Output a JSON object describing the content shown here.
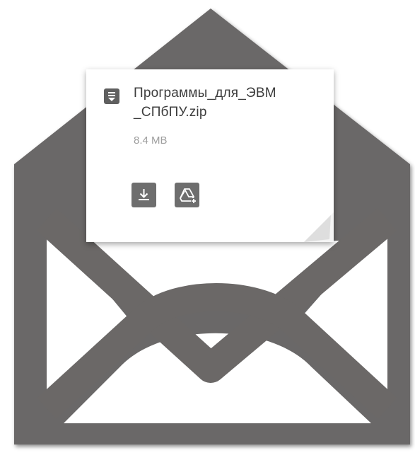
{
  "attachment": {
    "file_name_line1": "Программы_для_ЭВМ",
    "file_name_line2": "_СПбПУ.zip",
    "file_size": "8.4 MB",
    "file_icon": "archive-file-icon",
    "actions": [
      {
        "icon": "download-icon"
      },
      {
        "icon": "save-to-drive-icon"
      }
    ]
  },
  "colors": {
    "envelope": "#6b6867",
    "card_background": "#ffffff",
    "button_background": "#6e6e6e",
    "file_name_text": "#3d3d3d",
    "file_size_text": "#9e9e9e"
  }
}
